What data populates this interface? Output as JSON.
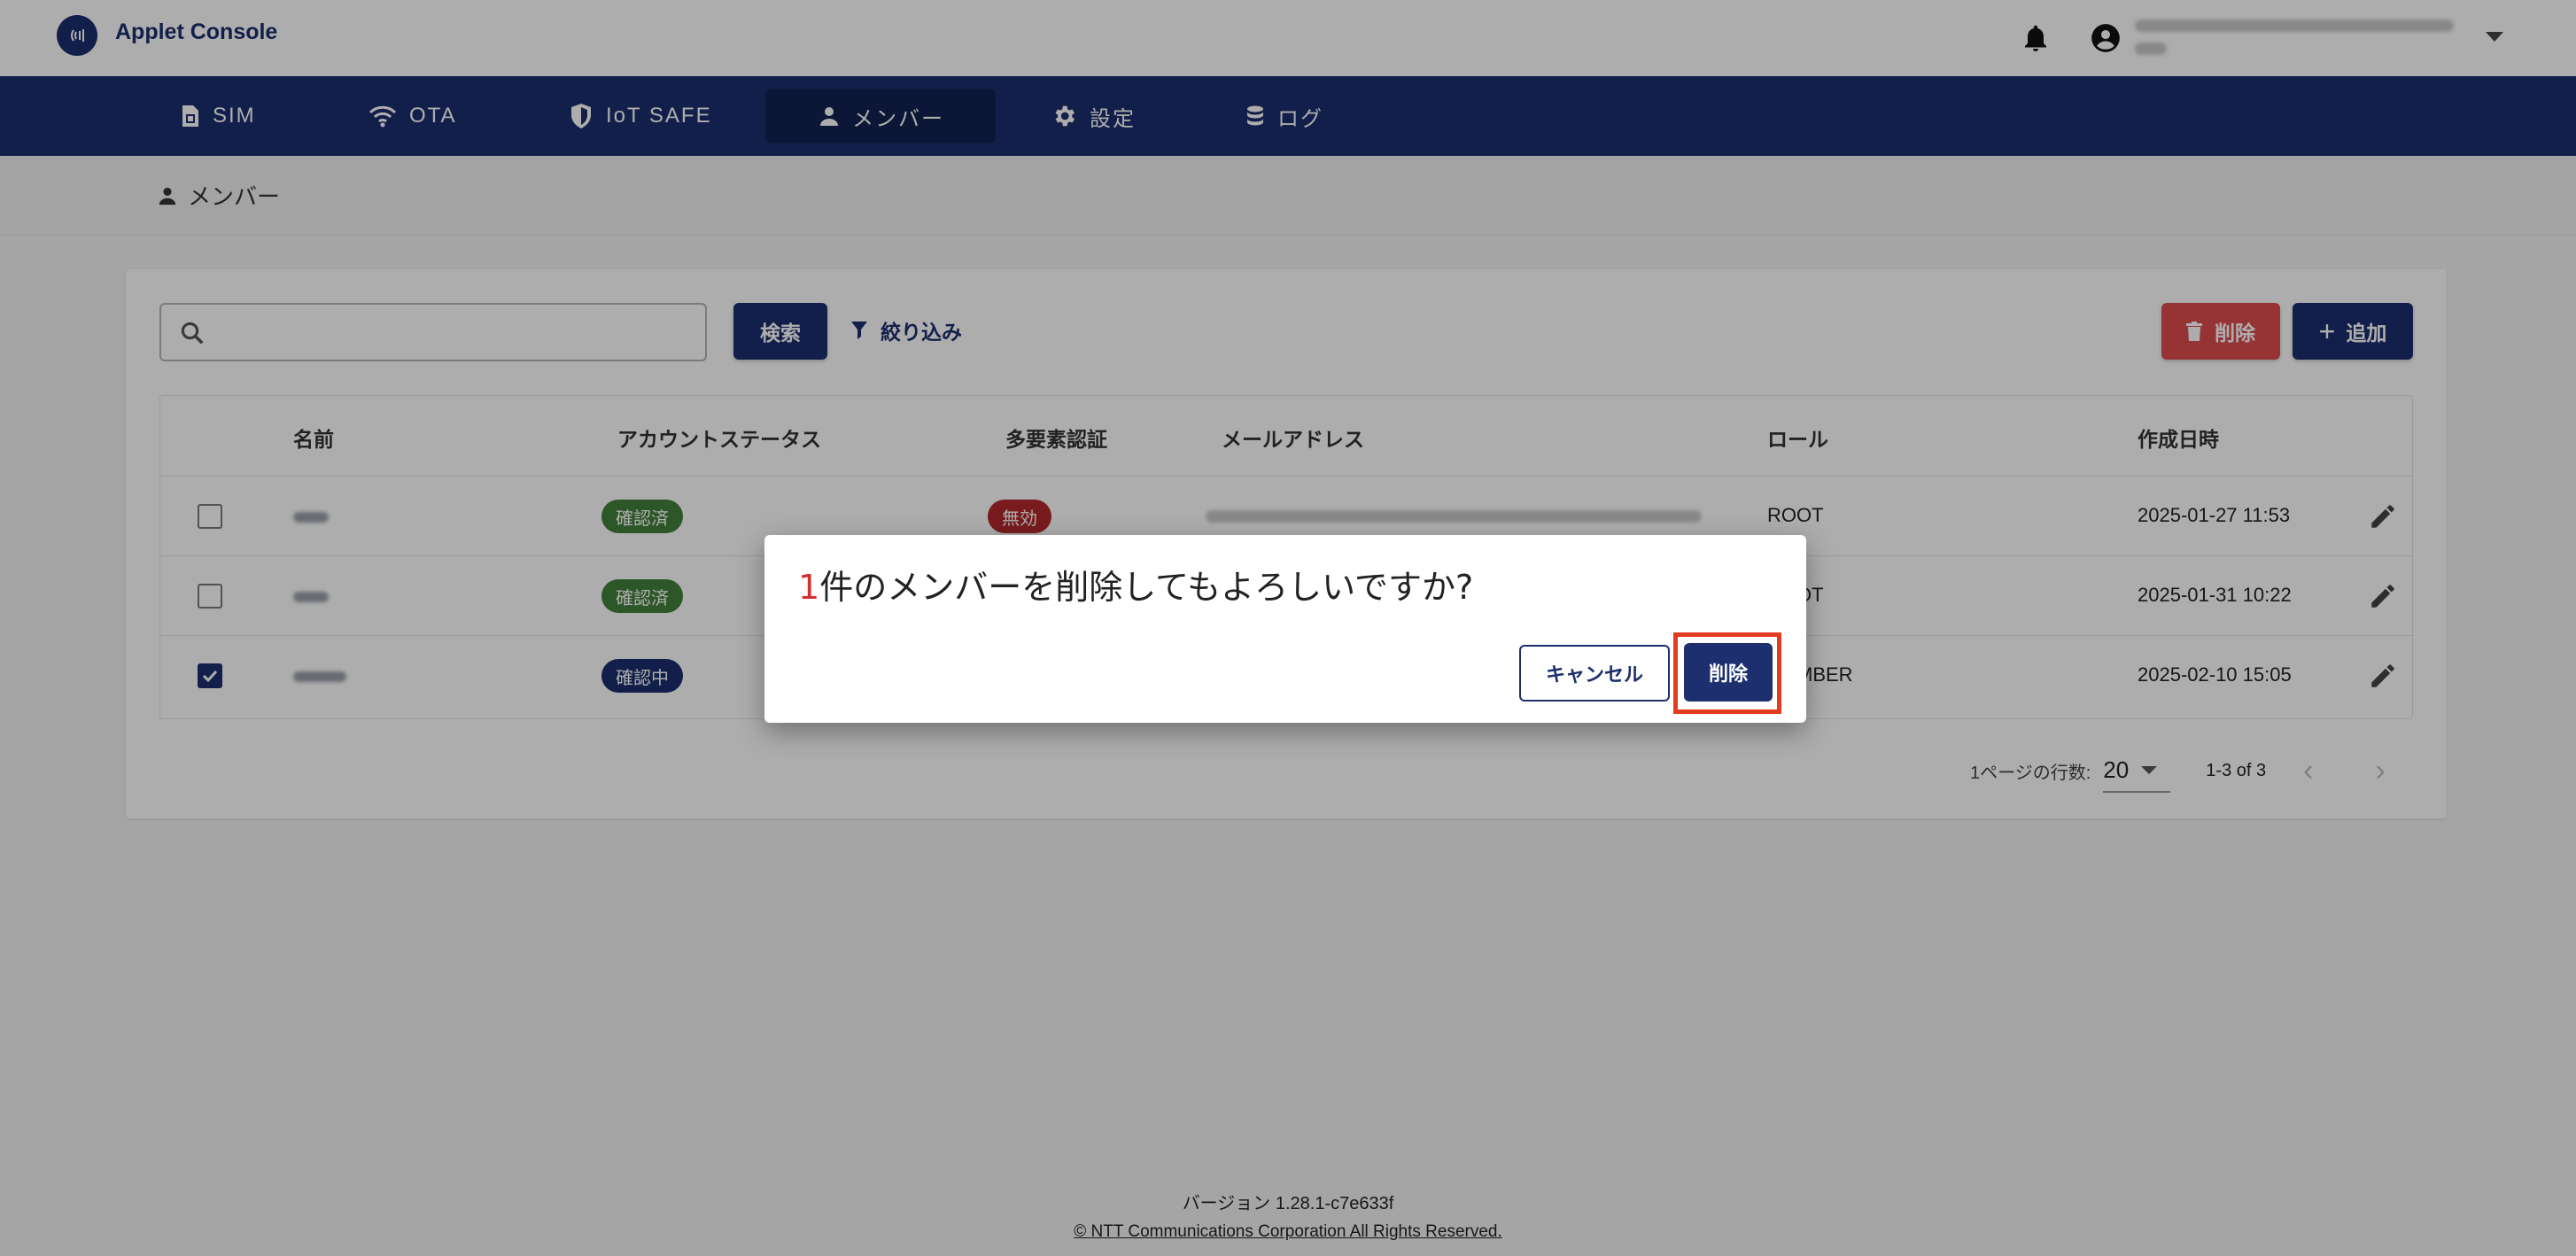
{
  "app": {
    "title": "Applet Console",
    "logo_icon": "signal-icon"
  },
  "header": {
    "notification_icon": "bell-icon",
    "account_icon": "account-circle-icon"
  },
  "nav": {
    "items": [
      {
        "label": "SIM",
        "icon": "sim-card-icon"
      },
      {
        "label": "OTA",
        "icon": "wifi-icon"
      },
      {
        "label": "IoT SAFE",
        "icon": "shield-icon"
      },
      {
        "label": "メンバー",
        "icon": "person-icon",
        "active": true
      },
      {
        "label": "設定",
        "icon": "gear-icon"
      },
      {
        "label": "ログ",
        "icon": "database-icon"
      }
    ]
  },
  "breadcrumb": {
    "label": "メンバー"
  },
  "toolbar": {
    "search_placeholder": "",
    "search_button": "検索",
    "filter_button": "絞り込み",
    "delete_button": "削除",
    "add_button": "追加"
  },
  "table": {
    "columns": [
      "名前",
      "アカウントステータス",
      "多要素認証",
      "メールアドレス",
      "ロール",
      "作成日時"
    ],
    "rows": [
      {
        "checked": false,
        "status": "確認済",
        "mfa": "無効",
        "role": "ROOT",
        "created": "2025-01-27 11:53"
      },
      {
        "checked": false,
        "status": "確認済",
        "mfa": "",
        "role": "ROOT",
        "created": "2025-01-31 10:22"
      },
      {
        "checked": true,
        "status": "確認中",
        "mfa": "",
        "role": "MEMBER",
        "created": "2025-02-10 15:05"
      }
    ]
  },
  "pagination": {
    "rows_label": "1ページの行数:",
    "rows_per_page": "20",
    "range": "1-3 of 3"
  },
  "footer": {
    "version": "バージョン 1.28.1-c7e633f",
    "copyright": "© NTT Communications Corporation All Rights Reserved."
  },
  "dialog": {
    "count": "1",
    "message": "件のメンバーを削除してもよろしいですか?",
    "cancel_label": "キャンセル",
    "confirm_label": "削除"
  },
  "colors": {
    "primary": "#1d2f6f",
    "danger": "#dd4c4f",
    "success": "#43803b",
    "highlight": "#e23b1f"
  }
}
